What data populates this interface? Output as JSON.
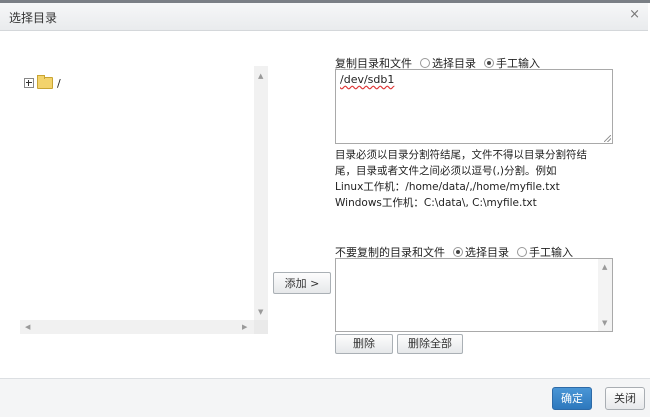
{
  "dialog": {
    "title": "选择目录",
    "close_glyph": "×"
  },
  "tree": {
    "root_label": "/",
    "root_icon": "folder-icon"
  },
  "add_button": {
    "label": "添加 >"
  },
  "copy_section": {
    "label": "复制目录和文件",
    "options": [
      "选择目录",
      "手工输入"
    ],
    "selected": "手工输入",
    "value": "/dev/sdb1"
  },
  "help_text": [
    "目录必须以目录分割符结尾，文件不得以目录分割符结",
    "尾，目录或者文件之间必须以逗号(,)分割。例如",
    "Linux工作机：/home/data/,/home/myfile.txt",
    "Windows工作机：C:\\data\\, C:\\myfile.txt"
  ],
  "exclude_section": {
    "label": "不要复制的目录和文件",
    "options": [
      "选择目录",
      "手工输入"
    ],
    "selected": "选择目录"
  },
  "buttons": {
    "delete": "删除",
    "delete_all": "删除全部",
    "ok": "确定",
    "close": "关闭"
  },
  "colors": {
    "primary": "#2d78bd"
  }
}
